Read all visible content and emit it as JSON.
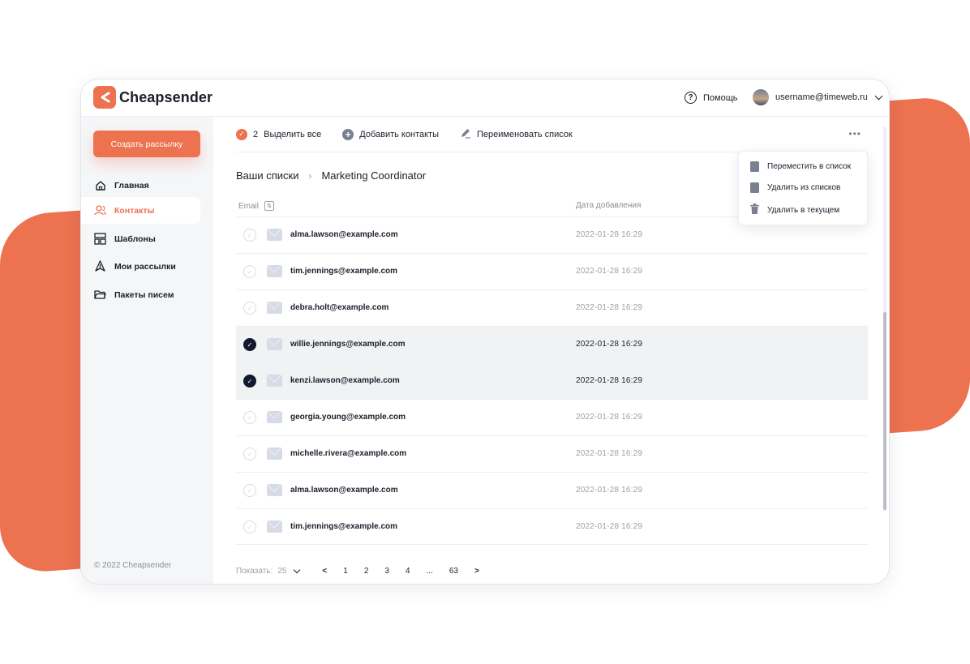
{
  "app": {
    "brand": "Cheapsender"
  },
  "header": {
    "help_label": "Помощь",
    "user_email": "username@timeweb.ru"
  },
  "sidebar": {
    "create_button": "Создать рассылку",
    "items": [
      {
        "label": "Главная",
        "icon": "home-icon"
      },
      {
        "label": "Контакты",
        "icon": "contacts-icon",
        "active": true
      },
      {
        "label": "Шаблоны",
        "icon": "templates-icon"
      },
      {
        "label": "Мои рассылки",
        "icon": "mailing-icon"
      },
      {
        "label": "Пакеты писем",
        "icon": "folder-icon"
      }
    ],
    "copyright": "© 2022 Cheapsender"
  },
  "toolbar": {
    "selected_count": "2",
    "select_all": "Выделить все",
    "add_contacts": "Добавить контакты",
    "rename_list": "Переименовать список",
    "more": "•••"
  },
  "dropdown": {
    "items": [
      "Переместить в список",
      "Удалить из списков",
      "Удалить в текущем"
    ]
  },
  "breadcrumb": {
    "root": "Ваши списки",
    "current": "Marketing Coordinator"
  },
  "table": {
    "col_email": "Email",
    "col_date": "Дата добавления",
    "rows": [
      {
        "email": "alma.lawson@example.com",
        "date": "2022-01-28  16:29",
        "selected": false
      },
      {
        "email": "tim.jennings@example.com",
        "date": "2022-01-28  16:29",
        "selected": false
      },
      {
        "email": "debra.holt@example.com",
        "date": "2022-01-28  16:29",
        "selected": false
      },
      {
        "email": "willie.jennings@example.com",
        "date": "2022-01-28  16:29",
        "selected": true
      },
      {
        "email": "kenzi.lawson@example.com",
        "date": "2022-01-28  16:29",
        "selected": true
      },
      {
        "email": "georgia.young@example.com",
        "date": "2022-01-28  16:29",
        "selected": false
      },
      {
        "email": "michelle.rivera@example.com",
        "date": "2022-01-28  16:29",
        "selected": false
      },
      {
        "email": "alma.lawson@example.com",
        "date": "2022-01-28  16:29",
        "selected": false
      },
      {
        "email": "tim.jennings@example.com",
        "date": "2022-01-28  16:29",
        "selected": false
      }
    ]
  },
  "pager": {
    "show_label": "Показать:",
    "per_page": "25",
    "prev": "<",
    "pages": [
      "1",
      "2",
      "3",
      "4",
      "...",
      "63"
    ],
    "next": ">"
  },
  "colors": {
    "accent": "#EC7250",
    "dark": "#141a2e"
  }
}
